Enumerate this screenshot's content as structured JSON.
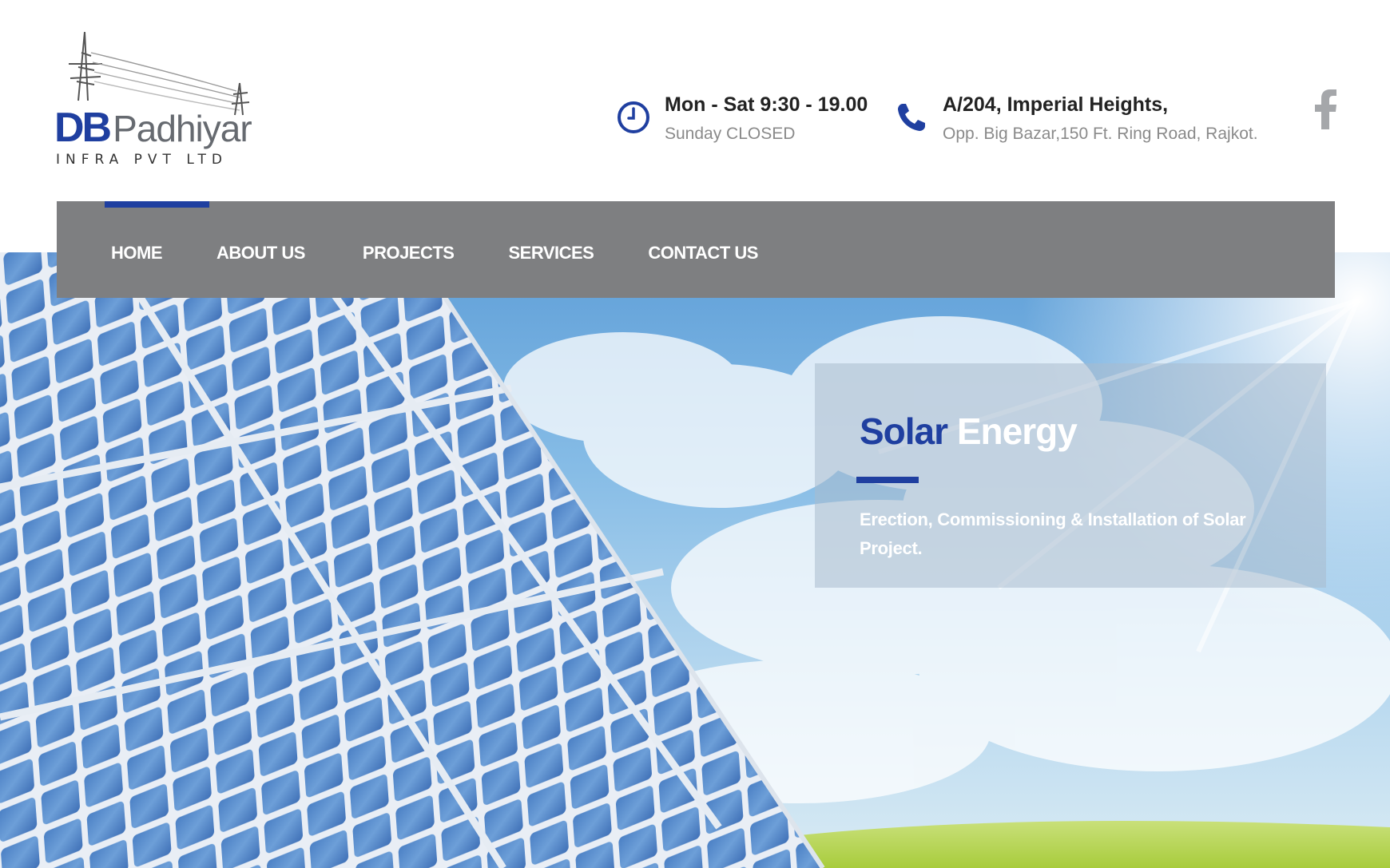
{
  "brand": {
    "primary": "DB",
    "name": "Padhiyar",
    "tagline": "Infra Pvt Ltd",
    "accent_color": "#1f3fa0",
    "gray_color": "#666a70"
  },
  "contact": {
    "hours_icon": "clock-icon",
    "hours_title": "Mon - Sat 9:30 - 19.00",
    "hours_sub": "Sunday CLOSED",
    "phone_icon": "phone-icon",
    "address_title": "A/204, Imperial Heights,",
    "address_sub": "Opp. Big Bazar,150 Ft. Ring Road, Rajkot."
  },
  "social": {
    "facebook_icon": "facebook-icon"
  },
  "nav": {
    "bg_color": "#7e7f81",
    "active": "HOME",
    "items": [
      {
        "label": "HOME"
      },
      {
        "label": "ABOUT US"
      },
      {
        "label": "PROJECTS"
      },
      {
        "label": "SERVICES"
      },
      {
        "label": "CONTACT US"
      }
    ]
  },
  "slide": {
    "title_part1": "Solar",
    "title_part2": "Energy",
    "text": "Erection, Commissioning & Installation of Solar Project.",
    "background": "solar-panels-sky"
  }
}
